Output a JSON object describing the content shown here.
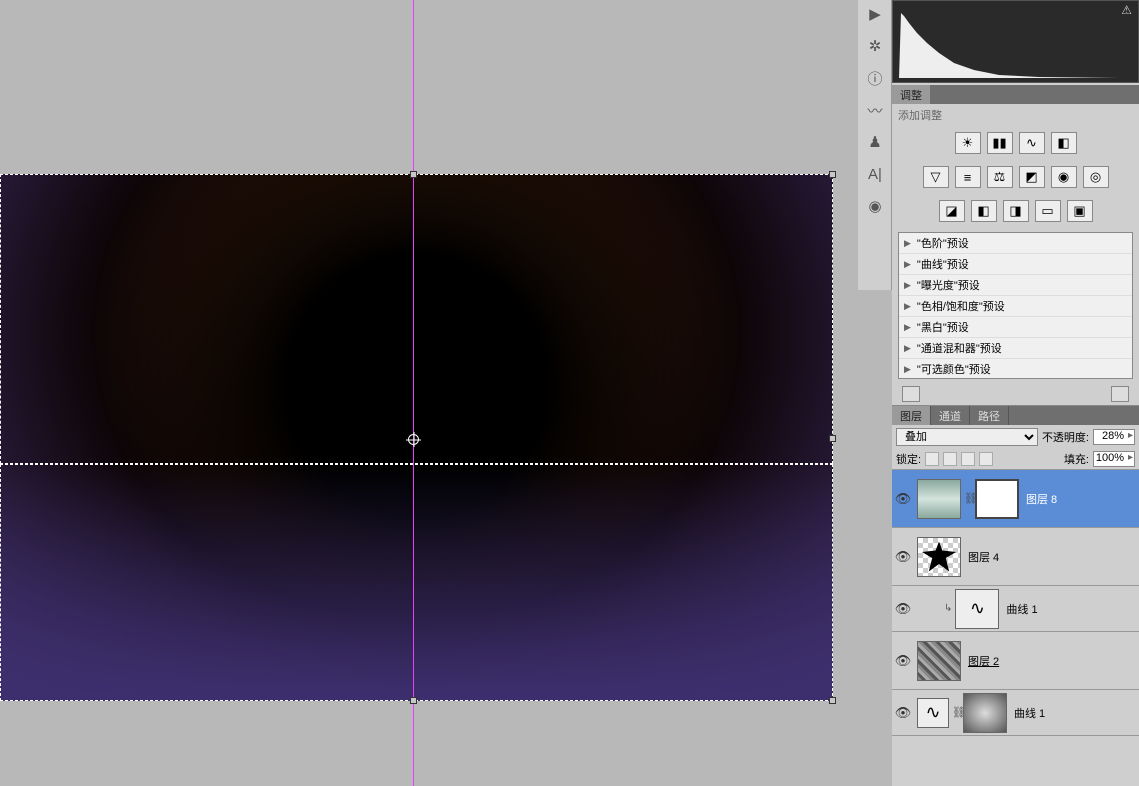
{
  "adjustments": {
    "tab": "调整",
    "hint": "添加调整",
    "presets": [
      "\"色阶\"预设",
      "\"曲线\"预设",
      "\"曝光度\"预设",
      "\"色相/饱和度\"预设",
      "\"黑白\"预设",
      "\"通道混和器\"预设",
      "\"可选颜色\"预设"
    ]
  },
  "layers": {
    "tabs": {
      "layer": "图层",
      "channel": "通道",
      "path": "路径"
    },
    "blend_mode": "叠加",
    "opacity_label": "不透明度:",
    "opacity_value": "28%",
    "lock_label": "锁定:",
    "fill_label": "填充:",
    "fill_value": "100%",
    "items": [
      {
        "name": "图层 8"
      },
      {
        "name": "图层 4"
      },
      {
        "name": "曲线 1"
      },
      {
        "name": "图层 2"
      },
      {
        "name": "曲线 1"
      }
    ]
  }
}
